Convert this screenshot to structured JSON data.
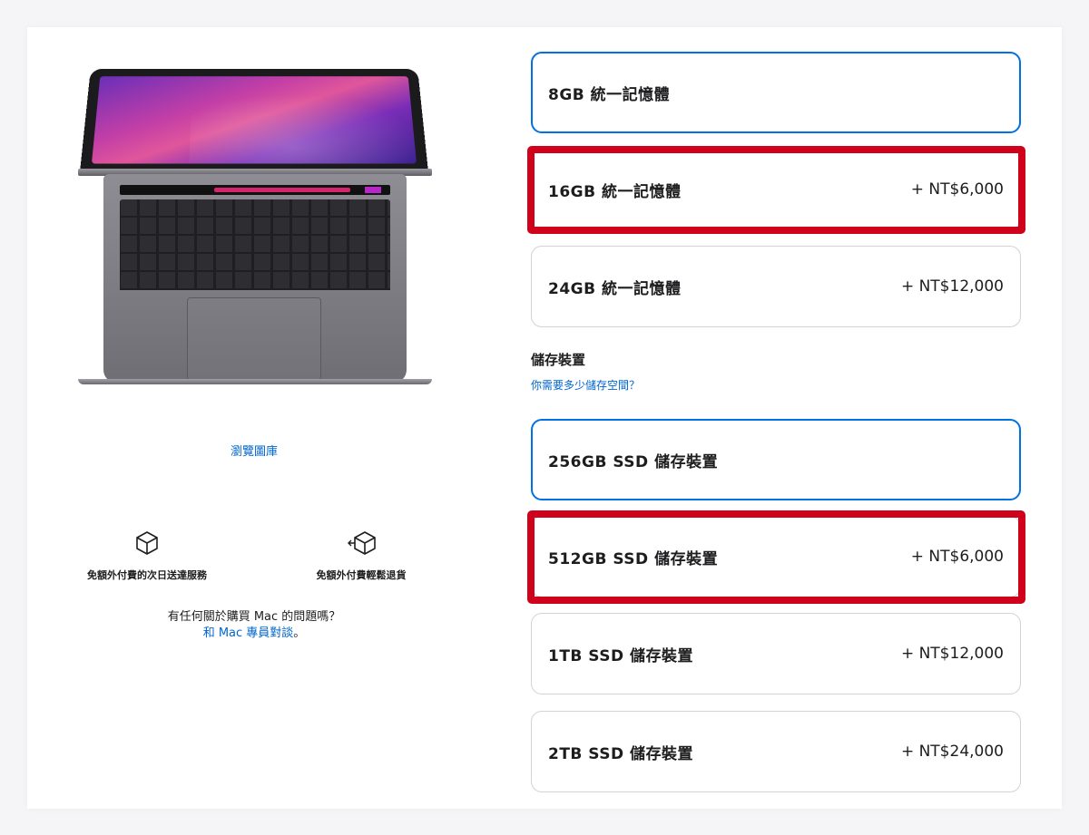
{
  "left": {
    "gallery_link": "瀏覽圖庫",
    "services": [
      {
        "icon": "box-icon",
        "label": "免額外付費的次日送達服務"
      },
      {
        "icon": "return-box-icon",
        "label": "免額外付費輕鬆退貨"
      }
    ],
    "help_question": "有任何關於購買 Mac 的問題嗎？",
    "help_link": "和 Mac 專員對談",
    "help_suffix": "。"
  },
  "memory": {
    "options": [
      {
        "name": "8GB 統一記憶體",
        "price": "",
        "selected": true,
        "highlighted": false
      },
      {
        "name": "16GB 統一記憶體",
        "price": "+ NT$6,000",
        "selected": false,
        "highlighted": true
      },
      {
        "name": "24GB 統一記憶體",
        "price": "+ NT$12,000",
        "selected": false,
        "highlighted": false
      }
    ]
  },
  "storage": {
    "title": "儲存裝置",
    "help_link": "你需要多少儲存空間？",
    "options": [
      {
        "name": "256GB SSD 儲存裝置",
        "price": "",
        "selected": true,
        "highlighted": false
      },
      {
        "name": "512GB SSD 儲存裝置",
        "price": "+ NT$6,000",
        "selected": false,
        "highlighted": true
      },
      {
        "name": "1TB SSD 儲存裝置",
        "price": "+ NT$12,000",
        "selected": false,
        "highlighted": false
      },
      {
        "name": "2TB SSD 儲存裝置",
        "price": "+ NT$24,000",
        "selected": false,
        "highlighted": false
      }
    ]
  },
  "colors": {
    "accent": "#0071e3",
    "link": "#0066cc",
    "highlight_annotation": "#d0021b"
  }
}
